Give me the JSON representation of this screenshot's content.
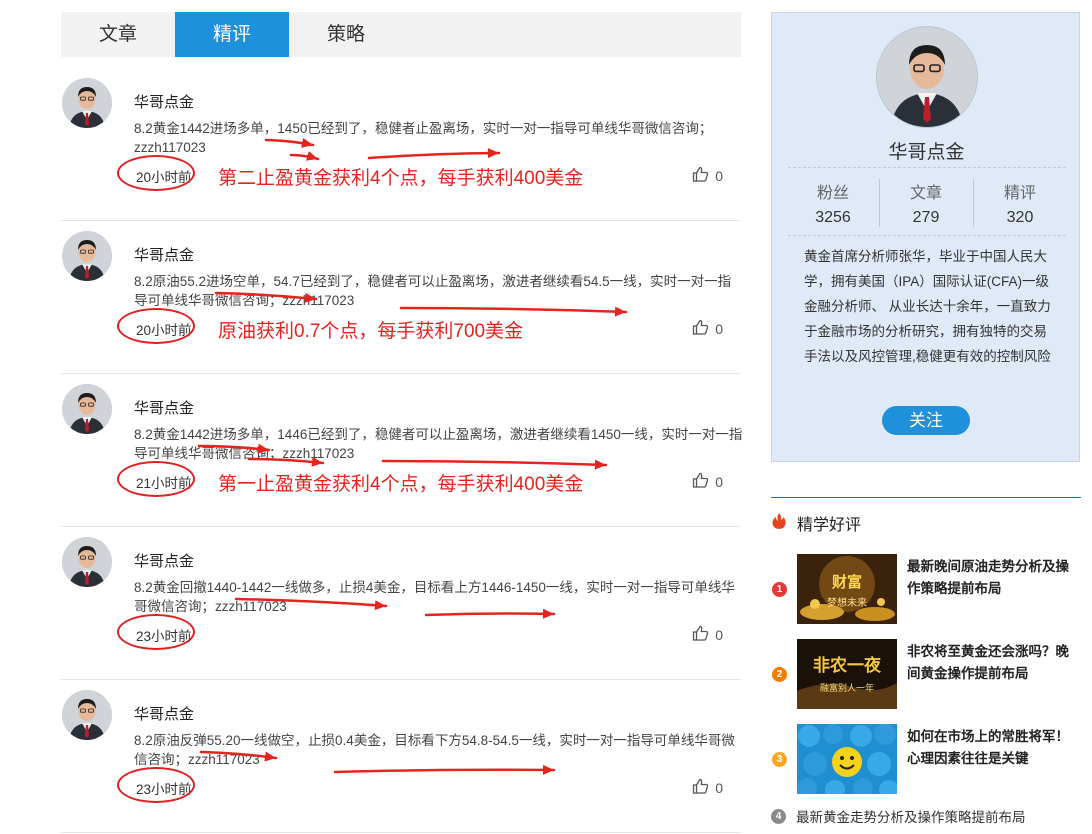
{
  "tabs": [
    {
      "label": "文章",
      "active": false
    },
    {
      "label": "精评",
      "active": true
    },
    {
      "label": "策略",
      "active": false
    }
  ],
  "posts": [
    {
      "author": "华哥点金",
      "text": "8.2黄金1442进场多单，1450已经到了，稳健者止盈离场，实时一对一指导可单线华哥微信咨询；zzzh117023",
      "time": "20小时前",
      "likes": "0",
      "annotation": "第二止盈黄金获利4个点，每手获利400美金"
    },
    {
      "author": "华哥点金",
      "text": "8.2原油55.2进场空单，54.7已经到了，稳健者可以止盈离场，激进者继续看54.5一线，实时一对一指导可单线华哥微信咨询；zzzh117023",
      "time": "20小时前",
      "likes": "0",
      "annotation": "原油获利0.7个点，每手获利700美金"
    },
    {
      "author": "华哥点金",
      "text": "8.2黄金1442进场多单，1446已经到了，稳健者可以止盈离场，激进者继续看1450一线，实时一对一指导可单线华哥微信咨询；zzzh117023",
      "time": "21小时前",
      "likes": "0",
      "annotation": "第一止盈黄金获利4个点，每手获利400美金"
    },
    {
      "author": "华哥点金",
      "text": "8.2黄金回撤1440-1442一线做多，止损4美金，目标看上方1446-1450一线，实时一对一指导可单线华哥微信咨询；zzzh117023",
      "time": "23小时前",
      "likes": "0",
      "annotation": ""
    },
    {
      "author": "华哥点金",
      "text": "8.2原油反弹55.20一线做空，止损0.4美金，目标看下方54.8-54.5一线，实时一对一指导可单线华哥微信咨询；zzzh117023",
      "time": "23小时前",
      "likes": "0",
      "annotation": ""
    }
  ],
  "profile": {
    "name": "华哥点金",
    "stats": [
      {
        "label": "粉丝",
        "value": "3256"
      },
      {
        "label": "文章",
        "value": "279"
      },
      {
        "label": "精评",
        "value": "320"
      }
    ],
    "bio": "黄金首席分析师张华，毕业于中国人民大学，拥有美国（IPA）国际认证(CFA)一级金融分析师、 从业长达十余年，一直致力于金融市场的分析研究，拥有独特的交易手法以及风控管理,稳健更有效的控制风险",
    "follow_label": "关注"
  },
  "hot": {
    "title": "精学好评",
    "items": [
      {
        "rank": "1",
        "title": "最新晚间原油走势分析及操作策略提前布局",
        "badge_color": "#e53935",
        "thumb_text": "财富 梦想未来"
      },
      {
        "rank": "2",
        "title": "非农将至黄金还会涨吗？晚间黄金操作提前布局",
        "badge_color": "#f57c00",
        "thumb_text": "非农一夜 融富别人一年"
      },
      {
        "rank": "3",
        "title": "如何在市场上的常胜将军！心理因素往往是关键",
        "badge_color": "#f9a825",
        "thumb_text": ""
      },
      {
        "rank": "4",
        "title": "最新黄金走势分析及操作策略提前布局",
        "badge_color": "#8a8a8a"
      }
    ]
  },
  "colors": {
    "accent": "#1e90dc",
    "annotation_red": "#e5231f",
    "card_bg": "#dfe9f7"
  },
  "icons": {
    "like": "thumbs-up-icon",
    "hot": "flame-icon"
  }
}
